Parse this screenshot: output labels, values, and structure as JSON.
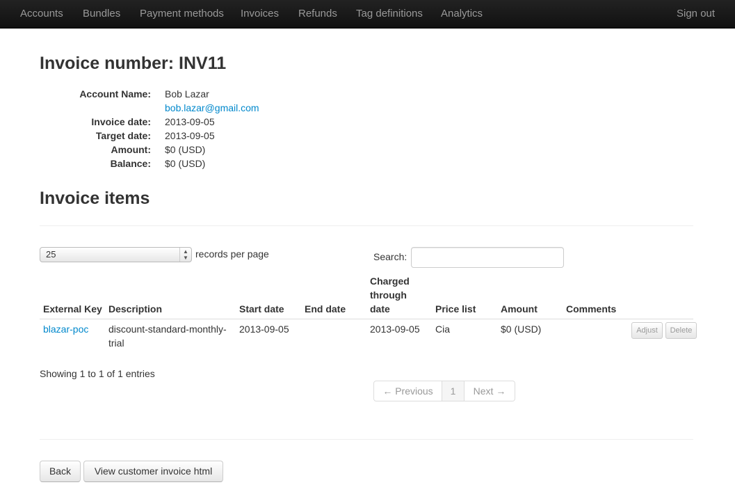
{
  "nav": {
    "items": [
      "Accounts",
      "Bundles",
      "Payment methods",
      "Invoices",
      "Refunds",
      "Tag definitions",
      "Analytics"
    ],
    "sign_out": "Sign out"
  },
  "invoice": {
    "title": "Invoice number: INV11",
    "account_name_label": "Account Name:",
    "account_name": "Bob Lazar",
    "account_email": "bob.lazar@gmail.com",
    "invoice_date_label": "Invoice date:",
    "invoice_date": "2013-09-05",
    "target_date_label": "Target date:",
    "target_date": "2013-09-05",
    "amount_label": "Amount:",
    "amount": "$0 (USD)",
    "balance_label": "Balance:",
    "balance": "$0 (USD)"
  },
  "items": {
    "title": "Invoice items",
    "page_size": "25",
    "records_per_page": "records per page",
    "search_label": "Search:",
    "search_value": "",
    "columns": {
      "external_key": "External Key",
      "description": "Description",
      "start_date": "Start date",
      "end_date": "End date",
      "charged_through_1": "Charged",
      "charged_through_2": "through",
      "charged_through_3": "date",
      "price_list": "Price list",
      "amount": "Amount",
      "comments": "Comments"
    },
    "rows": [
      {
        "external_key": "blazar-poc",
        "description_1": "discount-standard-monthly-",
        "description_2": "trial",
        "start_date": "2013-09-05",
        "end_date": "",
        "charged_through": "2013-09-05",
        "price_list": "Cia",
        "amount": "$0 (USD)",
        "comments": "",
        "adjust_label": "Adjust",
        "delete_label": "Delete"
      }
    ],
    "info": "Showing 1 to 1 of 1 entries",
    "pagination": {
      "previous": "← Previous",
      "page": "1",
      "next": "Next →"
    }
  },
  "actions": {
    "back": "Back",
    "view_html": "View customer invoice html"
  }
}
